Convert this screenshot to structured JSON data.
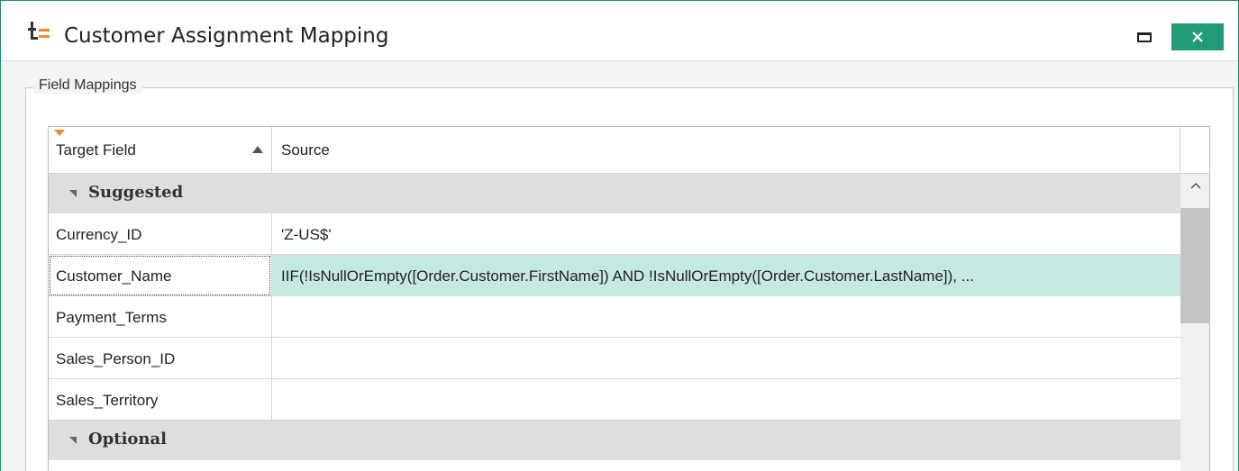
{
  "window": {
    "title": "Customer Assignment Mapping",
    "icon": "app-logo-icon",
    "accent_color": "#229b79"
  },
  "titlebar_buttons": [
    {
      "name": "maximize",
      "icon": "maximize-icon"
    },
    {
      "name": "close",
      "icon": "close-icon"
    }
  ],
  "group": {
    "legend": "Field Mappings"
  },
  "grid": {
    "columns": [
      {
        "label": "Target Field",
        "sort": "ascending",
        "filter_icon": "filter-icon"
      },
      {
        "label": "Source"
      }
    ],
    "groups": [
      {
        "label": "Suggested",
        "rows": [
          {
            "target": "Currency_ID",
            "source": "'Z-US$'"
          },
          {
            "target": "Customer_Name",
            "source": "IIF(!IsNullOrEmpty([Order.Customer.FirstName]) AND !IsNullOrEmpty([Order.Customer.LastName]), ..."
          },
          {
            "target": "Payment_Terms",
            "source": ""
          },
          {
            "target": "Sales_Person_ID",
            "source": ""
          },
          {
            "target": "Sales_Territory",
            "source": ""
          }
        ]
      },
      {
        "label": "Optional",
        "rows": []
      }
    ],
    "selected_row_color": "#c6e8e2"
  }
}
